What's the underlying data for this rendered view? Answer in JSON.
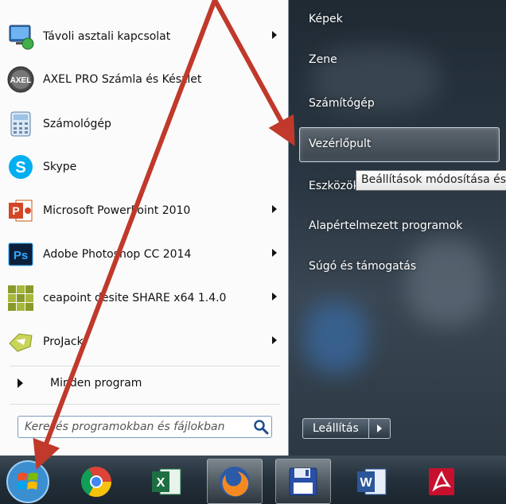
{
  "left_menu": {
    "programs": [
      {
        "label": "Távoli asztali kapcsolat",
        "icon": "remote-desktop-icon",
        "has_submenu": true
      },
      {
        "label": "AXEL PRO Számla és Készlet",
        "icon": "axel-pro-icon",
        "has_submenu": false
      },
      {
        "label": "Számológép",
        "icon": "calculator-icon",
        "has_submenu": false
      },
      {
        "label": "Skype",
        "icon": "skype-icon",
        "has_submenu": false
      },
      {
        "label": "Microsoft PowerPoint 2010",
        "icon": "powerpoint-icon",
        "has_submenu": true
      },
      {
        "label": "Adobe Photoshop CC 2014",
        "icon": "photoshop-icon",
        "has_submenu": true
      },
      {
        "label": "ceapoint desite SHARE x64 1.4.0",
        "icon": "desite-icon",
        "has_submenu": true
      },
      {
        "label": "ProJack",
        "icon": "projack-icon",
        "has_submenu": true
      }
    ],
    "all_programs": "Minden program",
    "search_placeholder": "Keresés programokban és fájlokban"
  },
  "right_menu": {
    "items": [
      "Képek",
      "Zene",
      "Számítógép",
      "Vezérlőpult",
      "Eszközök",
      "Alapértelmezett programok",
      "Súgó és támogatás"
    ],
    "highlighted": "Vezérlőpult",
    "tooltip": "Beállítások módosítása és",
    "shutdown": "Leállítás"
  },
  "taskbar": {
    "icons": [
      "windows-start-icon",
      "chrome-icon",
      "excel-icon",
      "firefox-icon",
      "save-floppy-icon",
      "word-icon",
      "acrobat-icon"
    ]
  },
  "colors": {
    "arrow": "#c0392b",
    "accent": "#1e6fb8"
  }
}
